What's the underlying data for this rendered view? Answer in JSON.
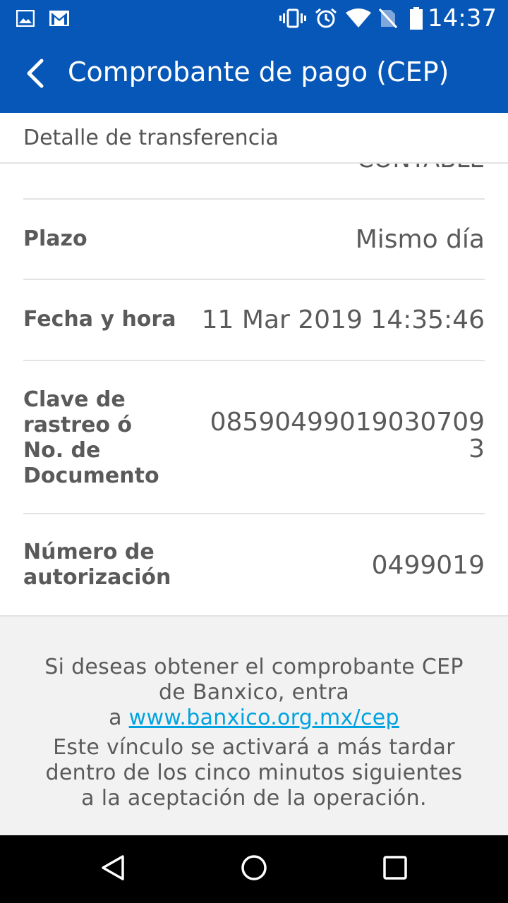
{
  "status_bar": {
    "time": "14:37",
    "left_icons": [
      "image-icon",
      "gmail-icon"
    ],
    "right_icons": [
      "vibrate-icon",
      "alarm-icon",
      "wifi-icon",
      "no-sim-icon",
      "battery-icon"
    ]
  },
  "app_bar": {
    "title": "Comprobante de pago (CEP)",
    "back_icon": "chevron-left-icon"
  },
  "section": {
    "title": "Detalle de transferencia"
  },
  "details": {
    "partial_value": "CONTABLE",
    "rows": [
      {
        "label": "Plazo",
        "value": "Mismo día"
      },
      {
        "label": "Fecha y hora",
        "value": "11 Mar 2019 14:35:46"
      },
      {
        "label_lines": [
          "Clave de",
          "rastreo ó",
          "No. de",
          "Documento"
        ],
        "value_lines": [
          "08590499019030709",
          "3"
        ]
      },
      {
        "label_lines": [
          "Número de",
          "autorización"
        ],
        "value": "0499019"
      }
    ]
  },
  "footer": {
    "line1": "Si deseas obtener el comprobante CEP",
    "line2": "de Banxico, entra",
    "line3_prefix": "a ",
    "link": "www.banxico.org.mx/cep",
    "line4": "Este vínculo se activará a más tardar",
    "line5": "dentro de los cinco minutos siguientes",
    "line6": "a la aceptación de la operación."
  },
  "nav_bar": {
    "icons": [
      "back-triangle-icon",
      "home-circle-icon",
      "recents-square-icon"
    ]
  },
  "colors": {
    "primary": "#0657b8",
    "link": "#00a3e0",
    "footer_bg": "#f2f2f2"
  }
}
